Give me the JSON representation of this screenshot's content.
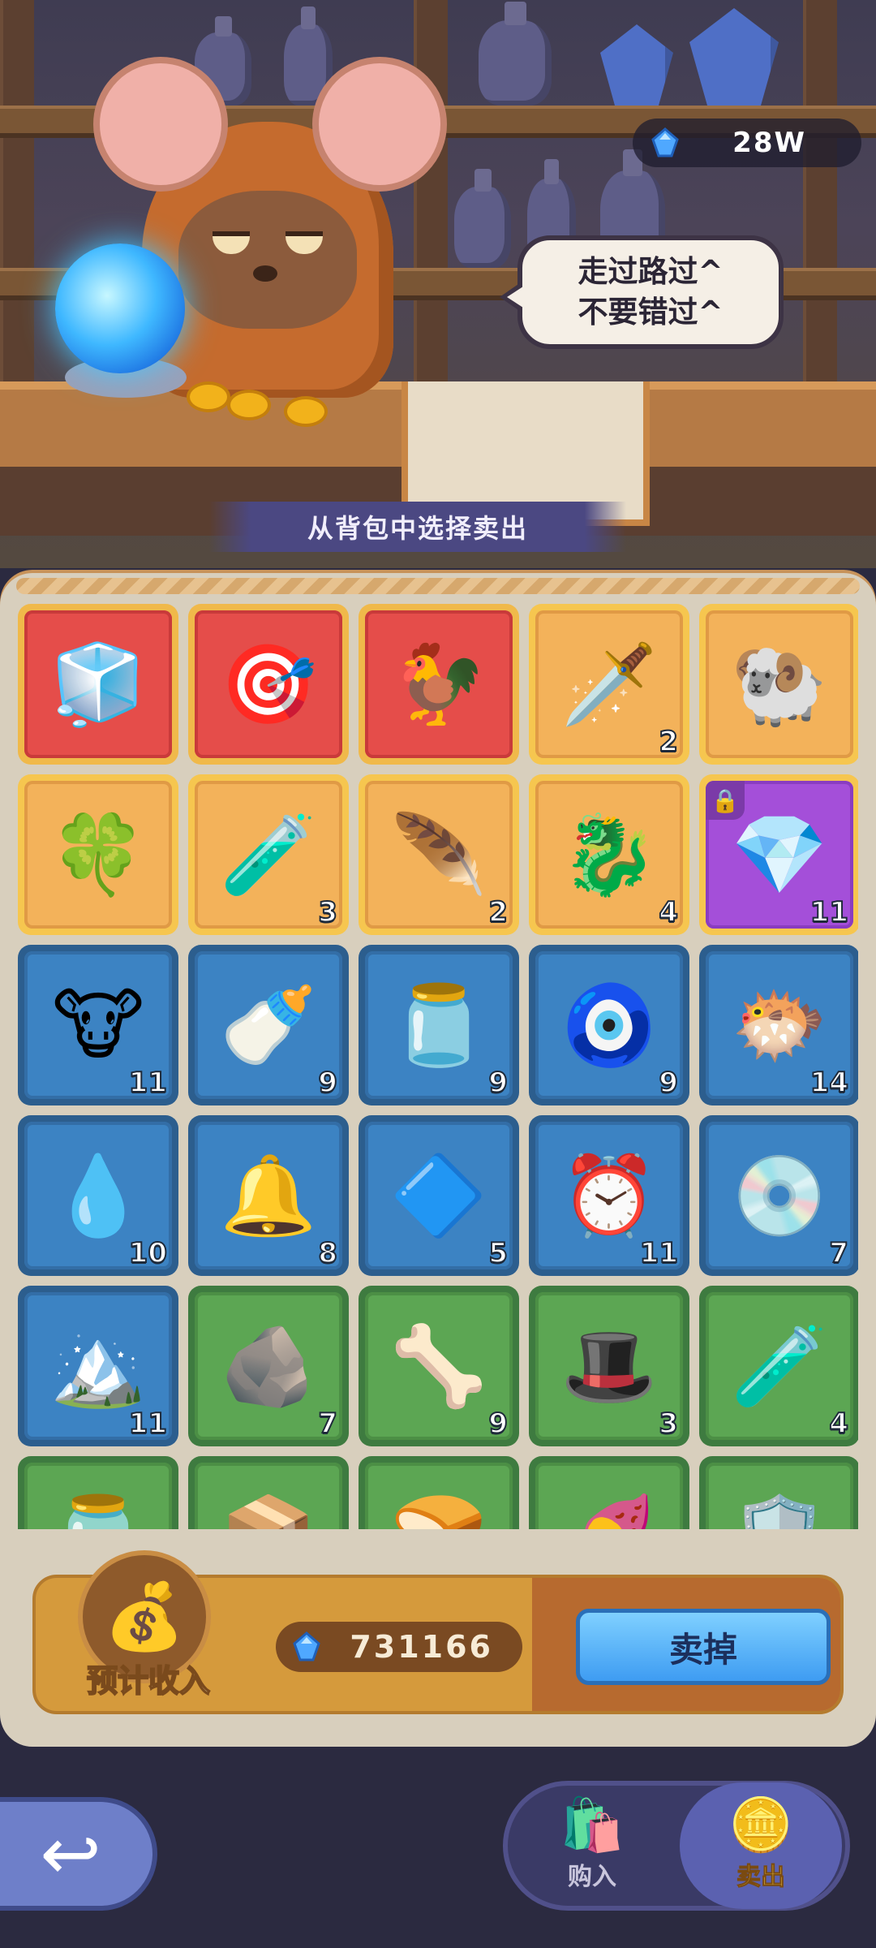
{
  "currency": {
    "icon": "blue-gem-icon",
    "amount": "28W"
  },
  "speech_bubble": {
    "line1": "走过路过^",
    "line2": "不要错过^"
  },
  "banner": {
    "text": "从背包中选择卖出"
  },
  "inventory": {
    "items": [
      {
        "name": "ice-cube",
        "glyph": "🧊",
        "rarity": "red",
        "count": ""
      },
      {
        "name": "gold-disk",
        "glyph": "🎯",
        "rarity": "red",
        "count": ""
      },
      {
        "name": "rooster",
        "glyph": "🐓",
        "rarity": "red",
        "count": ""
      },
      {
        "name": "golden-dagger",
        "glyph": "🗡️",
        "rarity": "gold",
        "count": "2"
      },
      {
        "name": "golden-sheep",
        "glyph": "🐏",
        "rarity": "gold",
        "count": ""
      },
      {
        "name": "clover-coin",
        "glyph": "🍀",
        "rarity": "gold",
        "count": ""
      },
      {
        "name": "star-potion",
        "glyph": "🧪",
        "rarity": "gold",
        "count": "3"
      },
      {
        "name": "golden-feather",
        "glyph": "🪶",
        "rarity": "gold",
        "count": "2"
      },
      {
        "name": "golden-dragon",
        "glyph": "🐉",
        "rarity": "gold",
        "count": "4"
      },
      {
        "name": "blue-gem",
        "glyph": "💎",
        "rarity": "purple",
        "count": "11",
        "locked": true
      },
      {
        "name": "bull-totem",
        "glyph": "🐮",
        "rarity": "blue",
        "count": "11"
      },
      {
        "name": "water-bottle",
        "glyph": "🍼",
        "rarity": "blue",
        "count": "9"
      },
      {
        "name": "potion-jar",
        "glyph": "🫙",
        "rarity": "blue",
        "count": "9"
      },
      {
        "name": "eye-charm",
        "glyph": "🧿",
        "rarity": "blue",
        "count": "9"
      },
      {
        "name": "puffer-fish",
        "glyph": "🐡",
        "rarity": "blue",
        "count": "14"
      },
      {
        "name": "water-drop",
        "glyph": "💧",
        "rarity": "blue",
        "count": "10"
      },
      {
        "name": "brass-bell",
        "glyph": "🔔",
        "rarity": "blue",
        "count": "8"
      },
      {
        "name": "crystal-shard",
        "glyph": "🔷",
        "rarity": "blue",
        "count": "5"
      },
      {
        "name": "alarm-clock",
        "glyph": "⏰",
        "rarity": "blue",
        "count": "11"
      },
      {
        "name": "cd-disc",
        "glyph": "💿",
        "rarity": "blue",
        "count": "7"
      },
      {
        "name": "mountain-crystal",
        "glyph": "🏔️",
        "rarity": "blue",
        "count": "11"
      },
      {
        "name": "stone-tablet",
        "glyph": "🪨",
        "rarity": "green",
        "count": "7"
      },
      {
        "name": "drill-horn",
        "glyph": "🦴",
        "rarity": "green",
        "count": "9"
      },
      {
        "name": "green-hat",
        "glyph": "🎩",
        "rarity": "green",
        "count": "3"
      },
      {
        "name": "green-potion",
        "glyph": "🧪",
        "rarity": "green",
        "count": "4"
      },
      {
        "name": "glass-jar",
        "glyph": "🫙",
        "rarity": "green",
        "count": ""
      },
      {
        "name": "gem-box",
        "glyph": "📦",
        "rarity": "green",
        "count": ""
      },
      {
        "name": "melon-bun",
        "glyph": "🍞",
        "rarity": "green",
        "count": ""
      },
      {
        "name": "sweet-potato",
        "glyph": "🍠",
        "rarity": "green",
        "count": ""
      },
      {
        "name": "blue-shield",
        "glyph": "🛡️",
        "rarity": "green",
        "count": ""
      }
    ]
  },
  "estimate": {
    "label": "预计收入",
    "bag_icon": "money-bag-icon",
    "amount": "731166",
    "sell_button": "卖掉"
  },
  "nav": {
    "back_icon": "back-arrow-icon",
    "buy_label": "购入",
    "sell_label": "卖出"
  }
}
